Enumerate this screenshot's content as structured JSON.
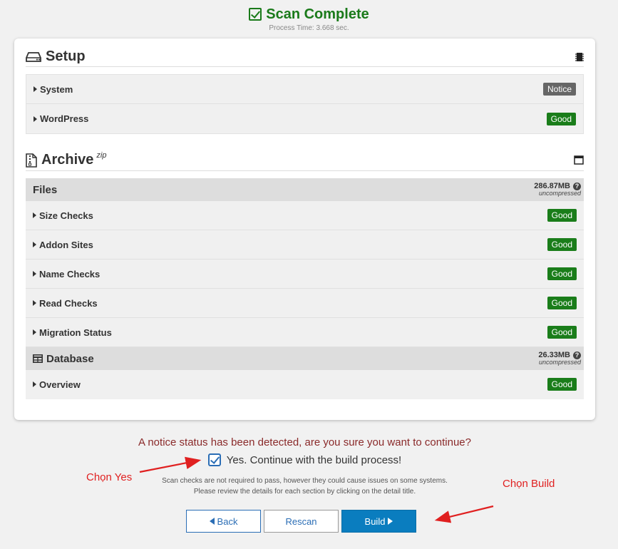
{
  "header": {
    "title": "Scan Complete",
    "subtitle": "Process Time: 3.668 sec."
  },
  "setup": {
    "title": "Setup",
    "rows": [
      {
        "label": "System",
        "status": "Notice"
      },
      {
        "label": "WordPress",
        "status": "Good"
      }
    ]
  },
  "archive": {
    "title": "Archive",
    "tag": "zip",
    "files": {
      "title": "Files",
      "size": "286.87MB",
      "size_note": "uncompressed",
      "rows": [
        {
          "label": "Size Checks",
          "status": "Good"
        },
        {
          "label": "Addon Sites",
          "status": "Good"
        },
        {
          "label": "Name Checks",
          "status": "Good"
        },
        {
          "label": "Read Checks",
          "status": "Good"
        },
        {
          "label": "Migration Status",
          "status": "Good"
        }
      ]
    },
    "database": {
      "title": "Database",
      "size": "26.33MB",
      "size_note": "uncompressed",
      "rows": [
        {
          "label": "Overview",
          "status": "Good"
        }
      ]
    }
  },
  "footer": {
    "notice": "A notice status has been detected, are you sure you want to continue?",
    "confirm_label": "Yes. Continue with the build process!",
    "note_line1": "Scan checks are not required to pass, however they could cause issues on some systems.",
    "note_line2": "Please review the details for each section by clicking on the detail title."
  },
  "buttons": {
    "back": "Back",
    "rescan": "Rescan",
    "build": "Build"
  },
  "annotations": {
    "yes": "Chọn Yes",
    "build": "Chọn Build"
  },
  "colors": {
    "good": "#1a7d1a",
    "notice": "#666666",
    "accent": "#0a7dbf",
    "title_green": "#1a7a1a",
    "annotation": "#e02020"
  }
}
